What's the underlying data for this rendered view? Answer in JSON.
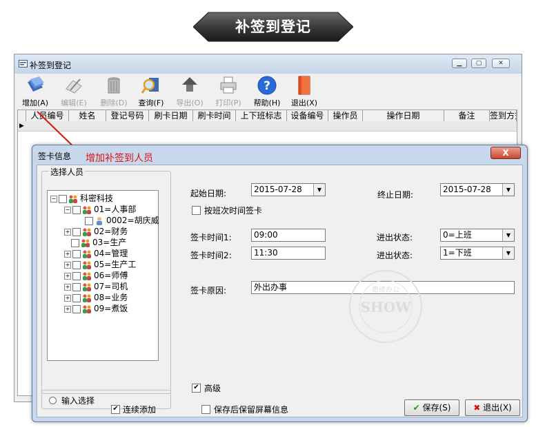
{
  "banner": {
    "title": "补签到登记"
  },
  "main_window": {
    "title": "补签到登记",
    "toolbar": [
      {
        "label": "增加(A)",
        "icon": "add-cards-icon",
        "enabled": true
      },
      {
        "label": "编辑(E)",
        "icon": "edit-pen-icon",
        "enabled": false
      },
      {
        "label": "删除(D)",
        "icon": "trash-can-icon",
        "enabled": false
      },
      {
        "label": "查询(F)",
        "icon": "magnifier-icon",
        "enabled": true
      },
      {
        "label": "导出(O)",
        "icon": "export-icon",
        "enabled": false
      },
      {
        "label": "打印(P)",
        "icon": "printer-icon",
        "enabled": false
      },
      {
        "label": "帮助(H)",
        "icon": "help-icon",
        "enabled": true
      },
      {
        "label": "退出(X)",
        "icon": "exit-door-icon",
        "enabled": true
      }
    ],
    "grid_columns": [
      "人员编号",
      "姓名",
      "登记号码",
      "刷卡日期",
      "刷卡时间",
      "上下班标志",
      "设备编号",
      "操作员",
      "操作日期",
      "备注",
      "签到方式"
    ],
    "row_indicator": "▶"
  },
  "annotation": "增加补签到人员",
  "dialog": {
    "title": "签卡信息",
    "close_label": "X",
    "group_label": "选择人员",
    "tree": [
      {
        "label": "科密科技",
        "depth": 0,
        "expander": "−"
      },
      {
        "label": "01=人事部",
        "depth": 1,
        "expander": "−"
      },
      {
        "label": "0002=胡庆威",
        "depth": 2,
        "expander": ""
      },
      {
        "label": "02=财务",
        "depth": 1,
        "expander": "+"
      },
      {
        "label": "03=生产",
        "depth": 1,
        "expander": ""
      },
      {
        "label": "04=管理",
        "depth": 1,
        "expander": "+"
      },
      {
        "label": "05=生产工",
        "depth": 1,
        "expander": "+"
      },
      {
        "label": "06=师傅",
        "depth": 1,
        "expander": "+"
      },
      {
        "label": "07=司机",
        "depth": 1,
        "expander": "+"
      },
      {
        "label": "08=业务",
        "depth": 1,
        "expander": "+"
      },
      {
        "label": "09=煮饭",
        "depth": 1,
        "expander": "+"
      }
    ],
    "input_select_label": "输入选择",
    "start_date_label": "起始日期:",
    "start_date": "2015-07-28",
    "end_date_label": "终止日期:",
    "end_date": "2015-07-28",
    "by_shift_label": "按班次时间签卡",
    "sign_time1_label": "签卡时间1:",
    "sign_time1": "09:00",
    "sign_time2_label": "签卡时间2:",
    "sign_time2": "11:30",
    "status1_label": "进出状态:",
    "status1": "0=上班",
    "status2_label": "进出状态:",
    "status2": "1=下班",
    "reason_label": "签卡原因:",
    "reason": "外出办事",
    "advanced_label": "高级",
    "continuous_add_label": "连续添加",
    "keep_screen_label": "保存后保留屏幕信息",
    "save_label": "保存(S)",
    "exit_label": "退出(X)"
  },
  "watermark": {
    "top": "奇绩办公",
    "main": "SHOW"
  }
}
